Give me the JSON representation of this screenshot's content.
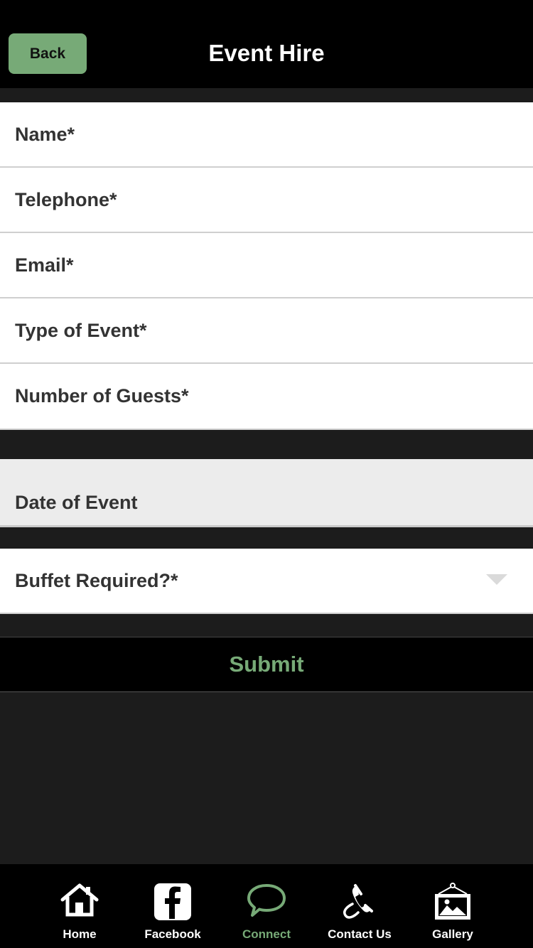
{
  "header": {
    "back_label": "Back",
    "title": "Event Hire"
  },
  "form": {
    "fields": [
      {
        "label": "Name*"
      },
      {
        "label": "Telephone*"
      },
      {
        "label": "Email*"
      },
      {
        "label": "Type of Event*"
      },
      {
        "label": "Number of Guests*"
      }
    ],
    "date_label": "Date of Event",
    "buffet_label": "Buffet Required?*",
    "submit_label": "Submit"
  },
  "tabbar": {
    "tabs": [
      {
        "label": "Home",
        "icon": "home-icon"
      },
      {
        "label": "Facebook",
        "icon": "facebook-icon"
      },
      {
        "label": "Connect",
        "icon": "chat-bubble-icon",
        "active": true
      },
      {
        "label": "Contact Us",
        "icon": "phone-icon"
      },
      {
        "label": "Gallery",
        "icon": "picture-frame-icon"
      }
    ]
  },
  "colors": {
    "accent": "#77aa77",
    "header_bg": "#000000",
    "page_bg": "#1c1c1c"
  }
}
